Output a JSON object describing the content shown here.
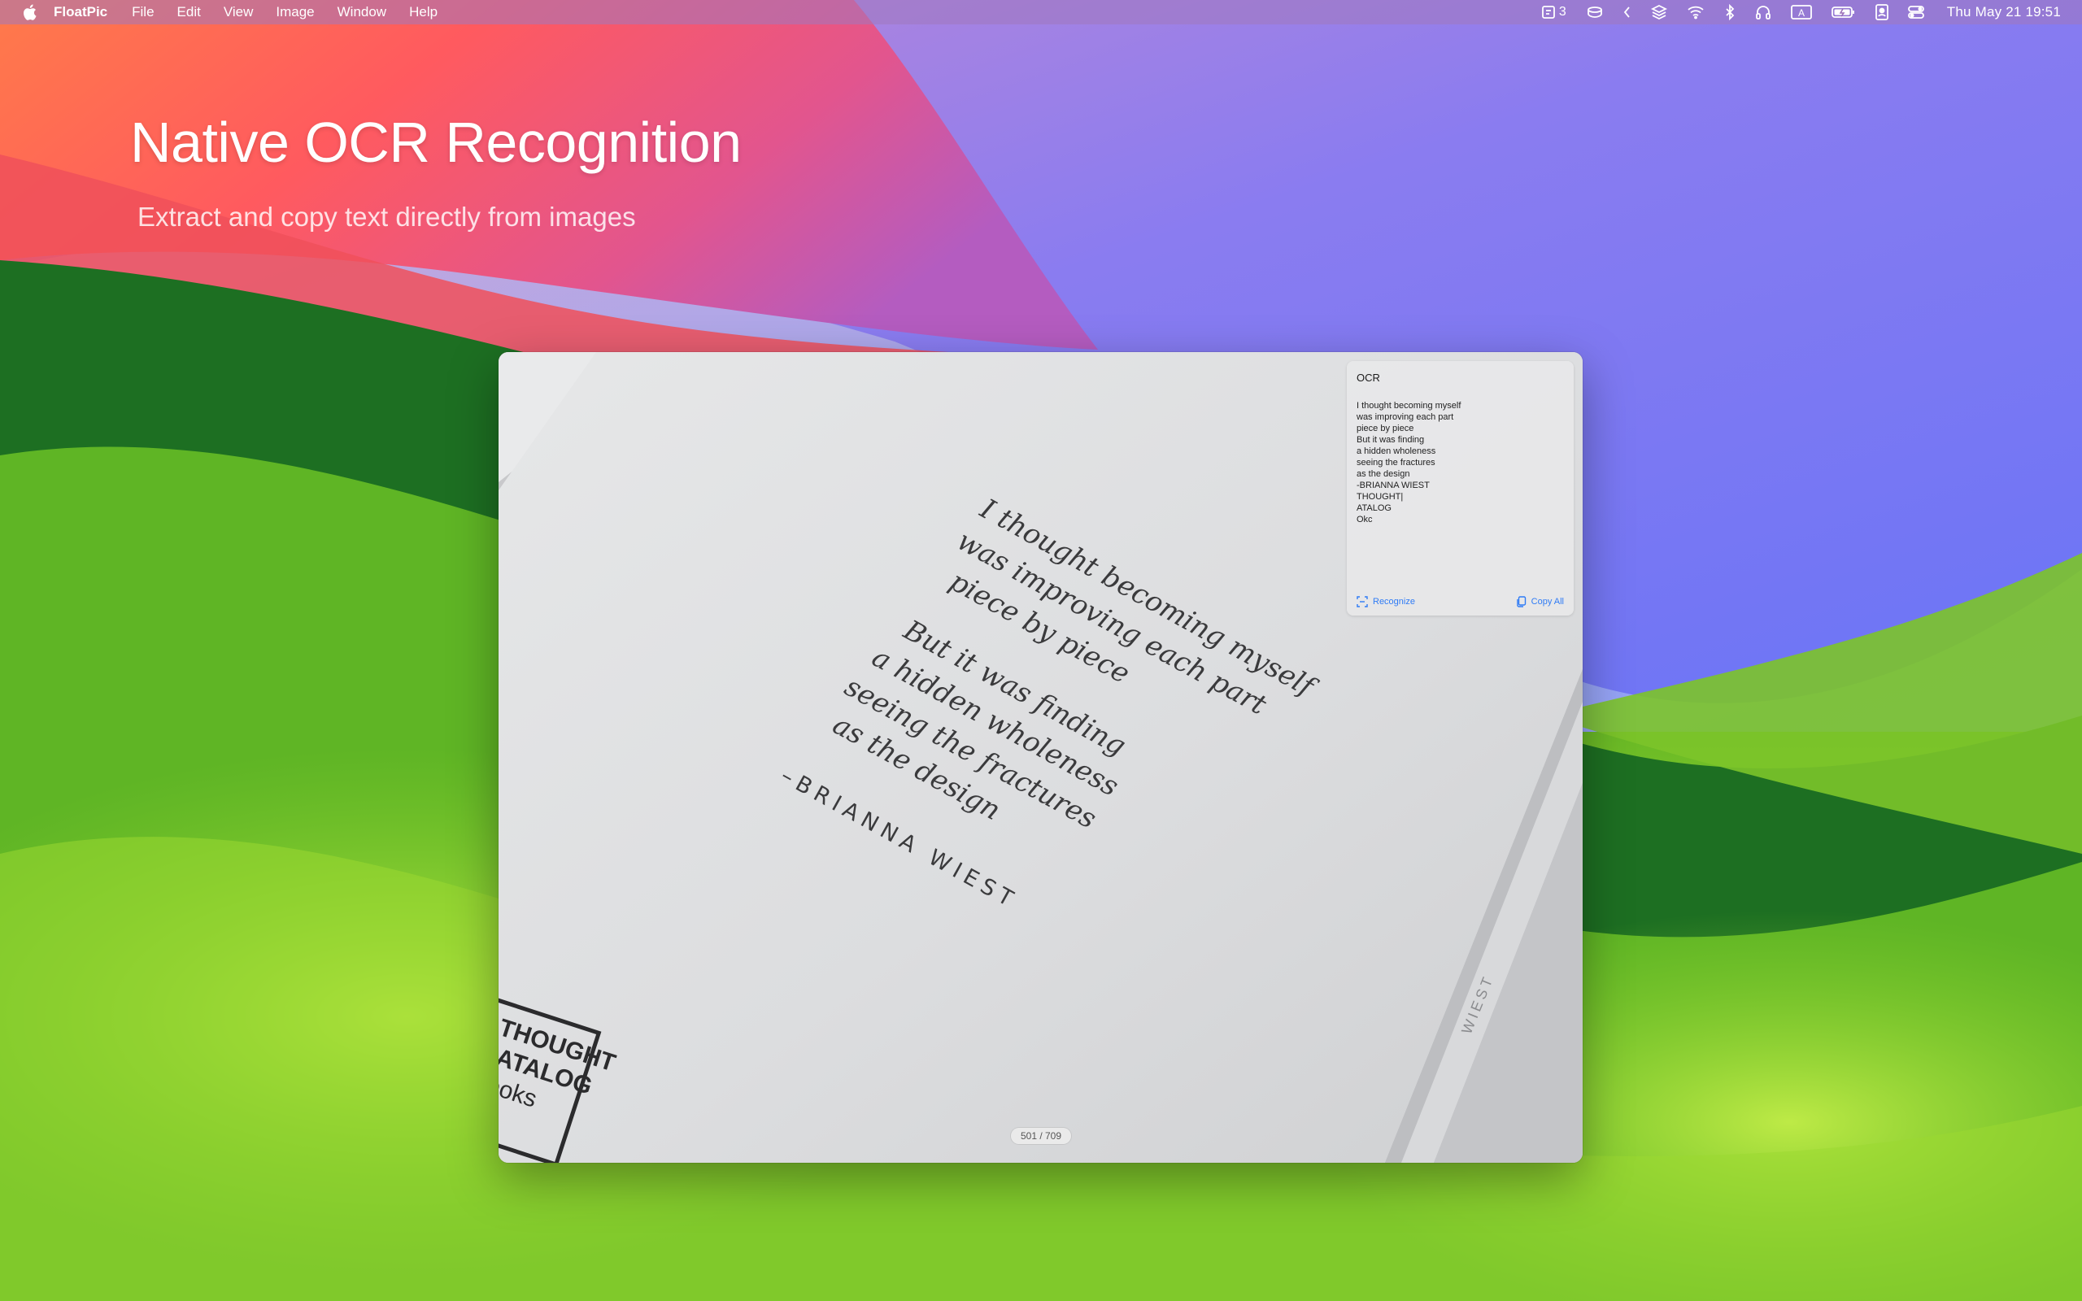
{
  "menubar": {
    "app_name": "FloatPic",
    "items": [
      "File",
      "Edit",
      "View",
      "Image",
      "Window",
      "Help"
    ],
    "notification_count": "3",
    "input_source": "A",
    "clock": "Thu May 21  19:51"
  },
  "hero": {
    "title": "Native OCR Recognition",
    "subtitle": "Extract and copy text directly from images"
  },
  "viewer": {
    "counter": "501 / 709",
    "photo": {
      "poem_lines": [
        "I thought becoming myself",
        "was improving each part",
        "piece by piece",
        "But it was finding",
        "a hidden wholeness",
        "seeing the fractures",
        "as the design"
      ],
      "author": "–BRIANNA WIEST",
      "stamp_lines": [
        "THOUGHT",
        "CATALOG",
        "books"
      ]
    }
  },
  "ocr": {
    "title": "OCR",
    "lines": [
      "I thought becoming myself",
      "was improving each part",
      "piece by piece",
      "But it was finding",
      "a hidden wholeness",
      "seeing the fractures",
      "as the design",
      "-BRIANNA WIEST",
      "THOUGHT|",
      "ATALOG",
      "Okc"
    ],
    "recognize_label": "Recognize",
    "copy_all_label": "Copy All"
  },
  "colors": {
    "accent": "#2f7bf5",
    "wallpaper_green": "#8bd12a",
    "wallpaper_red": "#ff5a5f",
    "wallpaper_violet": "#7a6cf4"
  }
}
